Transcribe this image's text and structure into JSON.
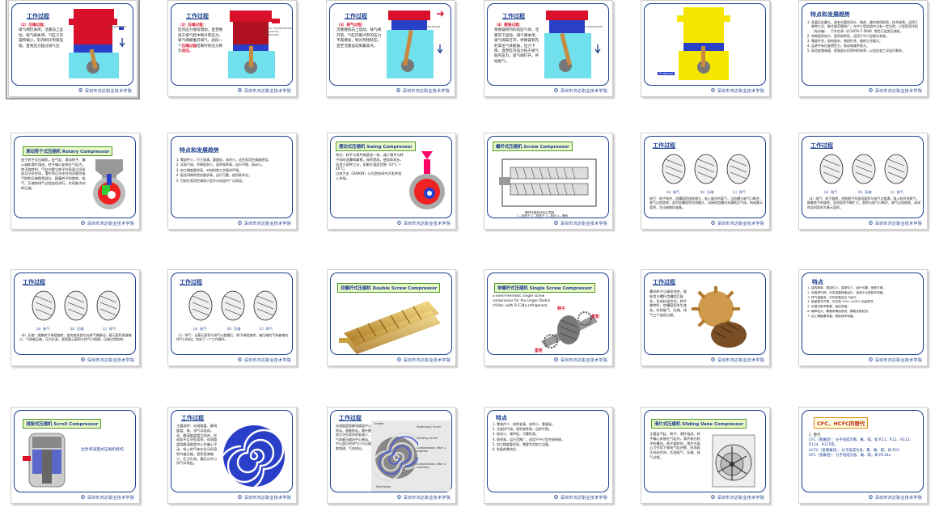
{
  "footer": {
    "logo": "⚙",
    "text": "深圳市鸿达职业技术学院"
  },
  "colors": {
    "frame": "#1b3f8f",
    "accent_red": "#d8102a",
    "badge_bg": "#eaf8c8",
    "badge_border": "#4c9a2a"
  },
  "slides": {
    "s1": {
      "title": "工作过程",
      "lines": [
        "（2）压缩过程：",
        "排气阀仍关闭，活塞向上运动，吸气阀关闭，气缸工作容积缩小，缸内制冷剂受压缩，直到压力超过排气压"
      ],
      "label": "Compression"
    },
    "s2": {
      "title": "工作过程",
      "lines": [
        "（2）压缩过程：",
        "缸内压力继续增加，直至略高于排气腔中制冷剂压力，排气阀被推开排气，此段一个",
        "压缩过程",
        "结束时的压力称为",
        "动压。"
      ],
      "label": "Over Compression (dynamic Pressure)"
    },
    "s3": {
      "title": "工作过程",
      "lines": [
        "（3）排气过程：",
        "活塞继续向上运动，排气阀开启，气缸内制冷剂的压力不再增加，制冷剂持续在，直至活塞运动到最高点。"
      ],
      "label": "Discharge"
    },
    "s4": {
      "title": "工作过程",
      "lines": [
        "（4）膨胀过程：",
        "余隙容积内的高压气体，活塞向下运动，排气阀关闭，吸气阀未打开，余隙容积内的高压气体膨胀，压力下降，直至缸内压力低于吸气腔内压力，吸气阀打开，开始吸气。"
      ],
      "label": "Re-Expansion"
    },
    "s5": {
      "label": "Produced"
    },
    "s6": {
      "title": "特点和发展趋势",
      "items": [
        "发展历史最久，具有丰富的设计、制造、操作使用经验，技术成熟，适用于各种工况，制冷量范围较广，在中小型机组中占有一定比例，小型家用冷柜（电冰箱）、汽车空调（约100%-7.5KW）常用于此类压缩机。",
        "余隙容积较大，容积效率低，适用于中小型制冷系统。",
        "零部件多，结构复杂，易损件多，维修工作量大。",
        "运转中有往复惯性力，振动和噪声较大。",
        "采用变频调速，提高部分负荷时的效率，以适应变工况运行需求。"
      ]
    },
    "s7": {
      "badge": "滚动转子式压缩机 Rotary Compressor",
      "lines": [
        "由于转子式压缩机，由气缸、滚动转子、偏心轴和滑片组成，转子偏心安装在气缸内，转子旋转时，气缸内壁与转子外表面之间形成月牙形空间，滑片将月牙形空间分隔为吸气腔和压缩腔两部分，随着转子的旋转，吸气、压缩和排气过程连续进行，实现制冷剂的压缩。"
      ]
    },
    "s8": {
      "title": "特点和发展趋势",
      "items": [
        "零部件少，尺寸紧凑，重量轻，体积小，适合家用空调器使用。",
        "无吸气阀，余隙容积小，容积效率高，运行平稳，振动小。",
        "加工精度要求高，对材料和工艺要求严格。",
        "配合间隙的密封要求高，运行可靠，使用寿命长。",
        "目前在家用空调和小型冷水机组中广泛采用。"
      ]
    },
    "s9": {
      "badge": "摆动式压缩机 Swing Compressor",
      "lines": [
        "特点：转子与滑片铸造成一体，减少滑片与转子间的泄漏和摩擦，效率提高，使用寿命长，适用于各种工况，如制冷温度范围 -10°C ~ 40°C。",
        "日本大金（DAIKIN）公司首先研究开发并投入市场。"
      ]
    },
    "s10": {
      "badge": "螺杆式压缩机 Screw Compressor",
      "caption": "螺杆压缩机结构示意图",
      "sub": "1—阴转子 2—阳转子 3—机体 4—滑阀"
    },
    "s11": {
      "title": "工作过程",
      "stage_labels": [
        "（a）吸气",
        "（b）压缩",
        "（c）排气"
      ],
      "lines": [
        "吸气：转子啮合，齿槽容积逐渐增大，吸入制冷剂蒸气，当齿槽与吸气口断开，吸气过程结束，此时齿槽容积达到最大，封闭的齿槽内充满低压气体，构成基元容积，为压缩做好准备。"
      ]
    },
    "s12": {
      "title": "工作过程",
      "stage_labels": [
        "（a）吸气",
        "（b）压缩",
        "（c）排气"
      ],
      "lines": [
        "（a）吸气：转子旋转，阴阳转子的齿间容积与吸气口相通，吸入制冷剂蒸气，随着转子的旋转，齿间容积不断扩大，直到与吸气口断开，吸气过程结束，封闭的齿间容积为基元容积。"
      ]
    },
    "s13": {
      "title": "工作过程",
      "stage_labels": [
        "（a）吸气",
        "（b）压缩",
        "（c）排气"
      ],
      "lines": [
        "（b）压缩：随着转子继续旋转，齿的啮合部位向排气端移动，基元容积逐渐缩小，气体被压缩，压力升高，直到基元容积与排气口相通，压缩过程结束。"
      ]
    },
    "s14": {
      "title": "工作过程",
      "stage_labels": [
        "（a）吸气",
        "（b）压缩",
        "（c）排气"
      ],
      "lines": [
        "（c）排气：当基元容积与排气口相通后，转子继续旋转，被压缩的气体被推向排气口排出，完成了一个工作循环。"
      ]
    },
    "s15": {
      "badge": "双螺杆式压缩机 Double Screw Compressor"
    },
    "s16": {
      "badge": "单螺杆式压缩机 Single Screw Compressor",
      "lines": [
        "a semi-hermetic single screw compressor for the larger Daikin chiller, with R-134a refrigerant."
      ],
      "tag_rotor": "转子",
      "tag_star1": "星轮",
      "tag_star2": "星轮"
    },
    "s17": {
      "title": "工作过程",
      "lines": [
        "螺杆转子与星轮啮合，星轮齿与螺杆齿槽相互配合，形成封闭空间，转子旋转时，齿槽容积发生变化，实现吸气、压缩、排气三个连续过程。"
      ]
    },
    "s18": {
      "title": "特点",
      "items": [
        "结构简单，零部件少，易损件少，运行可靠，维修方便。",
        "无吸排气阀，可实现高转速运行，适用于大型制冷机组。",
        "排气温度低，可在较高压比下运行。",
        "能量调节方便，可实现 10%～100% 无级调节。",
        "对湿行程不敏感，适应性强。",
        "噪声较大，需要润滑油系统，辅助设备较多。",
        "加工精度要求高，制造成本较高。"
      ]
    },
    "s19": {
      "badge": "涡旋式压缩机 Scroll Compressor",
      "lines": [
        "全封闭涡旋式压缩机结构"
      ]
    },
    "s20": {
      "title": "工作过程",
      "lines": [
        "主要部件：动涡旋盘、静涡旋盘、吸、排气口组成，动、静涡旋盘相互啮合，形成若干月牙形容积，动涡旋盘绕静涡旋盘中心作偏心平动，吸入的气体在月牙形容积内被压缩，容积逐渐缩小，压力升高，最后从中心排气口排出。"
      ]
    },
    "s21": {
      "title": "工作过程",
      "lines": [
        "动涡旋盘绕静涡旋盘中心转动，随着转动，最外圈的月牙形容积逐渐减小，气体被压缩向中心移动，中心部位的排气口与压缩腔相通，气体排出。"
      ],
      "tag": "Intake",
      "legend": [
        "Stationary Scroll",
        "Orbiting Scroll",
        "Compression after 1 rotation",
        "Compression after 2 rotations",
        "Discharge"
      ]
    },
    "s22": {
      "title": "特点",
      "items": [
        "零部件少，结构紧凑，体积小，重量轻。",
        "无吸排气阀，容积效率高，运转平稳。",
        "振动小，噪声低，可靠性高。",
        "效率高，运行范围广，适用于中小型空调系统。",
        "加工精度要求高，需要专用加工设备。",
        "发展前景良好。"
      ]
    },
    "s23": {
      "badge": "滑片式压缩机 Sliding Vane Compressor",
      "lines": [
        "主要由气缸、转子、滑片组成，转子偏心安装在气缸内，滑片装在转子的槽内，转子旋转时，滑片在离心力作用下紧贴气缸内壁，形成若干封闭空间，实现吸气、压缩、排气过程。"
      ]
    },
    "s24": {
      "badge": "CFC、HCFC的替代",
      "lines": [
        "1. 替代",
        "CFC（氯氟烃）：分子组成为氯、氟、碳。如 R11、R12、R113、R114、R115等。",
        "HCFC（氢氯氟烃）：分子组成为氢、氯、氟、碳。如 R22",
        "HFC（氢氟烃）：分子组成为氢、氟、碳。如 R134a"
      ]
    }
  }
}
